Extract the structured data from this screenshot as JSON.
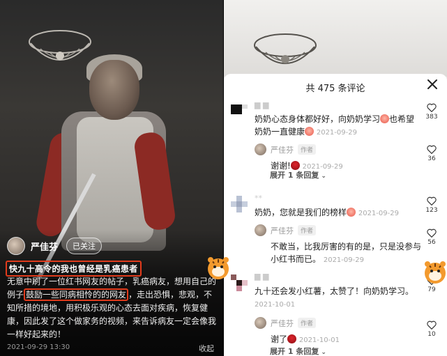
{
  "left": {
    "author": "严佳芬",
    "follow_label": "已关注",
    "title": "快九十高令的我也曾经是乳癌患者",
    "body_part1": "无意中刷了一位红书网友的帖子，乳癌病友，想用自己的例子",
    "body_highlight": "鼓励一些同病相怜的的网友",
    "body_part2": "，走出恐惧，悲观，不知所措的境地，用积极乐观的心态去面对疾病，恢复健康，因此发了这个做家务的视频，来告诉病友一定会像我一样好起来的！",
    "date": "2021-09-29 13:30",
    "collapse_label": "收起"
  },
  "sheet": {
    "title": "共 475 条评论",
    "comments": [
      {
        "text_a": "奶奶心态身体都好好，向奶奶学习",
        "text_b": "也希望奶奶一直健康",
        "date": "2021-09-29",
        "likes": "383",
        "reply": {
          "name": "严佳芬",
          "tag": "作者",
          "text": "谢谢!",
          "date": "2021-09-29",
          "likes": "36"
        },
        "expand": "展开 1 条回复"
      },
      {
        "name": "**",
        "text": "奶奶，您就是我们的榜样",
        "date": "2021-09-29",
        "likes": "123",
        "reply": {
          "name": "严佳芬",
          "tag": "作者",
          "text": "不敢当，比我厉害的有的是，只是没参与小红书而已。",
          "date": "2021-09-29",
          "likes": "56"
        }
      },
      {
        "text": "九十还会发小红薯，太赞了！向奶奶学习。",
        "date": "2021-10-01",
        "likes": "79",
        "reply": {
          "name": "严佳芬",
          "tag": "作者",
          "text": "谢了",
          "date": "2021-10-01",
          "likes": "10"
        },
        "expand": "展开 1 条回复"
      }
    ]
  }
}
